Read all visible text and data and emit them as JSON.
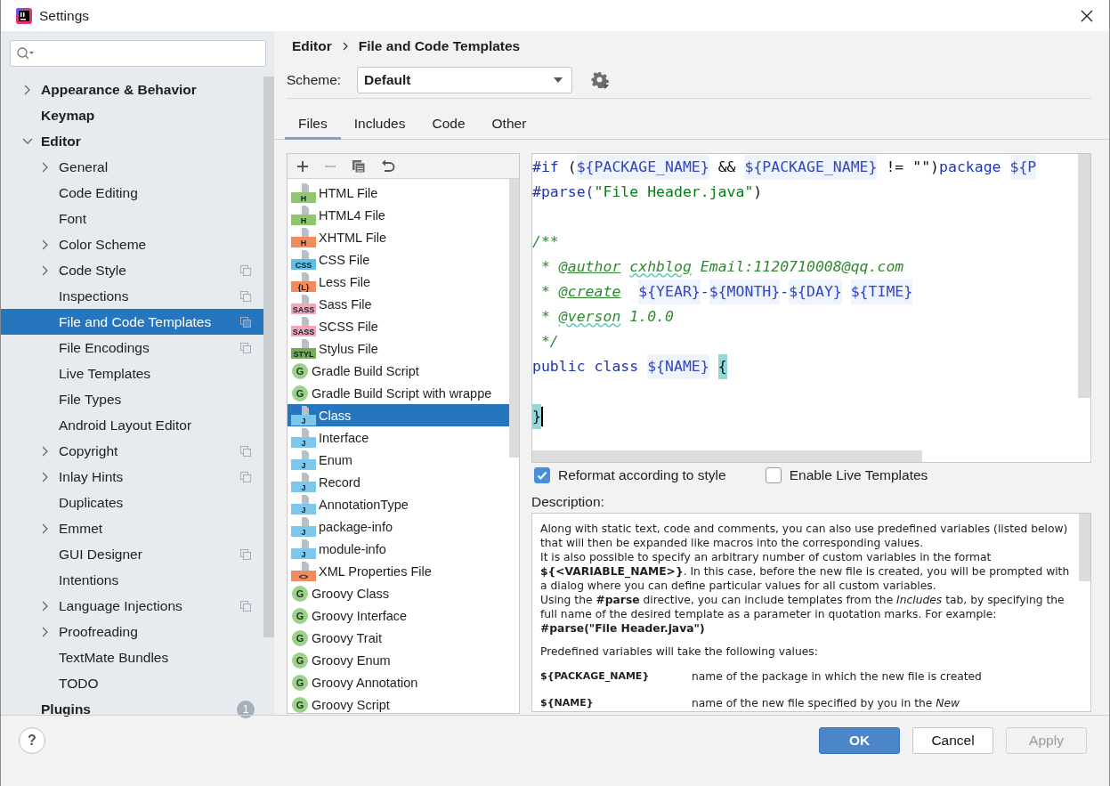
{
  "window": {
    "title": "Settings"
  },
  "sidebar": {
    "items": [
      {
        "label": "Appearance & Behavior",
        "expandable": true,
        "expanded": false,
        "selected": false,
        "scoped": false
      },
      {
        "label": "Keymap",
        "expandable": false,
        "selected": false,
        "scoped": false
      },
      {
        "label": "Editor",
        "expandable": true,
        "expanded": true,
        "selected": false,
        "scoped": false,
        "children": [
          {
            "label": "General",
            "expandable": true,
            "expanded": false,
            "selected": false,
            "scoped": false
          },
          {
            "label": "Code Editing",
            "expandable": false,
            "selected": false,
            "scoped": false
          },
          {
            "label": "Font",
            "expandable": false,
            "selected": false,
            "scoped": false
          },
          {
            "label": "Color Scheme",
            "expandable": true,
            "expanded": false,
            "selected": false,
            "scoped": false
          },
          {
            "label": "Code Style",
            "expandable": true,
            "expanded": false,
            "selected": false,
            "scoped": true
          },
          {
            "label": "Inspections",
            "expandable": false,
            "selected": false,
            "scoped": true
          },
          {
            "label": "File and Code Templates",
            "expandable": false,
            "selected": true,
            "scoped": true
          },
          {
            "label": "File Encodings",
            "expandable": false,
            "selected": false,
            "scoped": true
          },
          {
            "label": "Live Templates",
            "expandable": false,
            "selected": false,
            "scoped": false
          },
          {
            "label": "File Types",
            "expandable": false,
            "selected": false,
            "scoped": false
          },
          {
            "label": "Android Layout Editor",
            "expandable": false,
            "selected": false,
            "scoped": false
          },
          {
            "label": "Copyright",
            "expandable": true,
            "expanded": false,
            "selected": false,
            "scoped": true
          },
          {
            "label": "Inlay Hints",
            "expandable": true,
            "expanded": false,
            "selected": false,
            "scoped": true
          },
          {
            "label": "Duplicates",
            "expandable": false,
            "selected": false,
            "scoped": false
          },
          {
            "label": "Emmet",
            "expandable": true,
            "expanded": false,
            "selected": false,
            "scoped": false
          },
          {
            "label": "GUI Designer",
            "expandable": false,
            "selected": false,
            "scoped": true
          },
          {
            "label": "Intentions",
            "expandable": false,
            "selected": false,
            "scoped": false
          },
          {
            "label": "Language Injections",
            "expandable": true,
            "expanded": false,
            "selected": false,
            "scoped": true
          },
          {
            "label": "Proofreading",
            "expandable": true,
            "expanded": false,
            "selected": false,
            "scoped": false
          },
          {
            "label": "TextMate Bundles",
            "expandable": false,
            "selected": false,
            "scoped": false
          },
          {
            "label": "TODO",
            "expandable": false,
            "selected": false,
            "scoped": false
          }
        ]
      },
      {
        "label": "Plugins",
        "expandable": false,
        "selected": false,
        "scoped": false,
        "badge": "1"
      }
    ]
  },
  "breadcrumb": [
    "Editor",
    "File and Code Templates"
  ],
  "scheme": {
    "label": "Scheme:",
    "value": "Default"
  },
  "tabs": [
    {
      "label": "Files",
      "selected": true
    },
    {
      "label": "Includes",
      "selected": false
    },
    {
      "label": "Code",
      "selected": false
    },
    {
      "label": "Other",
      "selected": false
    }
  ],
  "templates": [
    {
      "label": "HTML File",
      "kind": "file",
      "badge": "H",
      "color": "#8fc66e",
      "selected": false
    },
    {
      "label": "HTML4 File",
      "kind": "file",
      "badge": "H",
      "color": "#8fc66e",
      "selected": false
    },
    {
      "label": "XHTML File",
      "kind": "file",
      "badge": "H",
      "color": "#f28b5e",
      "selected": false
    },
    {
      "label": "CSS File",
      "kind": "file",
      "badge": "CSS",
      "color": "#62bde3",
      "selected": false
    },
    {
      "label": "Less File",
      "kind": "file",
      "badge": "{L}",
      "color": "#f08a5d",
      "selected": false
    },
    {
      "label": "Sass File",
      "kind": "file",
      "badge": "SASS",
      "color": "#f4a6b9",
      "selected": false
    },
    {
      "label": "SCSS File",
      "kind": "file",
      "badge": "SASS",
      "color": "#f4a6b9",
      "selected": false
    },
    {
      "label": "Stylus File",
      "kind": "file",
      "badge": "STYL",
      "color": "#76aa55",
      "selected": false
    },
    {
      "label": "Gradle Build Script",
      "kind": "groovy",
      "badge": "G",
      "color": "#9dd28c",
      "selected": false
    },
    {
      "label": "Gradle Build Script with wrappe",
      "kind": "groovy",
      "badge": "G",
      "color": "#9dd28c",
      "selected": false
    },
    {
      "label": "Class",
      "kind": "file",
      "badge": "J",
      "color": "#7cc8ec",
      "selected": true
    },
    {
      "label": "Interface",
      "kind": "file",
      "badge": "J",
      "color": "#7cc8ec",
      "selected": false
    },
    {
      "label": "Enum",
      "kind": "file",
      "badge": "J",
      "color": "#7cc8ec",
      "selected": false
    },
    {
      "label": "Record",
      "kind": "file",
      "badge": "J",
      "color": "#7cc8ec",
      "selected": false
    },
    {
      "label": "AnnotationType",
      "kind": "file",
      "badge": "J",
      "color": "#7cc8ec",
      "selected": false
    },
    {
      "label": "package-info",
      "kind": "file",
      "badge": "J",
      "color": "#7cc8ec",
      "selected": false
    },
    {
      "label": "module-info",
      "kind": "file",
      "badge": "J",
      "color": "#7cc8ec",
      "selected": false
    },
    {
      "label": "XML Properties File",
      "kind": "file",
      "badge": "<>",
      "color": "#f28b5e",
      "selected": false
    },
    {
      "label": "Groovy Class",
      "kind": "groovy",
      "badge": "G",
      "color": "#9dd28c",
      "selected": false
    },
    {
      "label": "Groovy Interface",
      "kind": "groovy",
      "badge": "G",
      "color": "#9dd28c",
      "selected": false
    },
    {
      "label": "Groovy Trait",
      "kind": "groovy",
      "badge": "G",
      "color": "#9dd28c",
      "selected": false
    },
    {
      "label": "Groovy Enum",
      "kind": "groovy",
      "badge": "G",
      "color": "#9dd28c",
      "selected": false
    },
    {
      "label": "Groovy Annotation",
      "kind": "groovy",
      "badge": "G",
      "color": "#9dd28c",
      "selected": false
    },
    {
      "label": "Groovy Script",
      "kind": "groovy",
      "badge": "G",
      "color": "#9dd28c",
      "selected": false
    }
  ],
  "editor": {
    "lines": [
      {
        "kind": "code",
        "caret": false,
        "segments": [
          {
            "text": "#if",
            "kind": "keyword"
          },
          {
            "text": " (",
            "kind": "plain"
          },
          {
            "text": "${PACKAGE_NAME}",
            "kind": "variable"
          },
          {
            "text": " && ",
            "kind": "plain"
          },
          {
            "text": "${PACKAGE_NAME}",
            "kind": "variable"
          },
          {
            "text": " != \"\")",
            "kind": "plain"
          },
          {
            "text": "package ",
            "kind": "keyword"
          },
          {
            "text": "${P",
            "kind": "variable"
          }
        ]
      },
      {
        "kind": "code",
        "caret": false,
        "segments": [
          {
            "text": "#parse(",
            "kind": "keyword"
          },
          {
            "text": "\"File Header.java\"",
            "kind": "string"
          },
          {
            "text": ")",
            "kind": "plain"
          }
        ]
      },
      {
        "kind": "blank",
        "caret": false
      },
      {
        "kind": "code",
        "caret": false,
        "segments": [
          {
            "text": "/**",
            "kind": "comment"
          }
        ]
      },
      {
        "kind": "code",
        "caret": false,
        "segments": [
          {
            "text": " * ",
            "kind": "comment"
          },
          {
            "text": "@author",
            "kind": "tag"
          },
          {
            "text": " cxhblog",
            "kind": "typo"
          },
          {
            "text": " Email:1120710008@qq.com",
            "kind": "comment"
          }
        ]
      },
      {
        "kind": "code",
        "caret": false,
        "segments": [
          {
            "text": " * ",
            "kind": "comment"
          },
          {
            "text": "@create",
            "kind": "tag"
          },
          {
            "text": "  ${YEAR}",
            "kind": "variable"
          },
          {
            "text": "-",
            "kind": "keyword"
          },
          {
            "text": "${MONTH}",
            "kind": "variable"
          },
          {
            "text": "-",
            "kind": "keyword"
          },
          {
            "text": "${DAY}",
            "kind": "variable"
          },
          {
            "text": " ${TIME}",
            "kind": "variable"
          }
        ]
      },
      {
        "kind": "code",
        "caret": false,
        "segments": [
          {
            "text": " * ",
            "kind": "comment"
          },
          {
            "text": "@verson",
            "kind": "typo"
          },
          {
            "text": " 1.0.0",
            "kind": "comment"
          }
        ]
      },
      {
        "kind": "code",
        "caret": false,
        "segments": [
          {
            "text": " */",
            "kind": "comment"
          }
        ]
      },
      {
        "kind": "code",
        "caret": false,
        "segments": [
          {
            "text": "public class ",
            "kind": "keyword"
          },
          {
            "text": "${NAME}",
            "kind": "variable"
          },
          {
            "text": " {",
            "kind": "brace"
          }
        ]
      },
      {
        "kind": "blank",
        "caret": false
      },
      {
        "kind": "code",
        "caret": true,
        "segments": [
          {
            "text": "}",
            "kind": "brace"
          }
        ]
      }
    ]
  },
  "options": [
    {
      "label": "Reformat according to style",
      "checked": true
    },
    {
      "label": "Enable Live Templates",
      "checked": false
    }
  ],
  "description": {
    "label": "Description:",
    "paragraphs": [
      "Along with static text, code and comments, you can also use predefined variables (listed below) that will then be expanded like macros into the corresponding values.",
      "It is also possible to specify an arbitrary number of custom variables in the format **${<VARIABLE_NAME>}**. In this case, before the new file is created, you will be prompted with a dialog where you can define particular values for all custom variables.",
      "Using the **#parse** directive, you can include templates from the *Includes* tab, by specifying the full name of the desired template as a parameter in quotation marks. For example:",
      "**#parse(\"File Header.java\")**"
    ],
    "predefined": "Predefined variables will take the following values:",
    "variables": [
      {
        "name": "${PACKAGE_NAME}",
        "text": "name of the package in which the new file is created"
      },
      {
        "name": "${NAME}",
        "text": "name of the new file specified by you in the *New*"
      }
    ]
  },
  "help": "?",
  "buttons": [
    {
      "label": "OK",
      "primary": true,
      "disabled": false
    },
    {
      "label": "Cancel",
      "primary": false,
      "disabled": false
    },
    {
      "label": "Apply",
      "primary": false,
      "disabled": true
    }
  ]
}
